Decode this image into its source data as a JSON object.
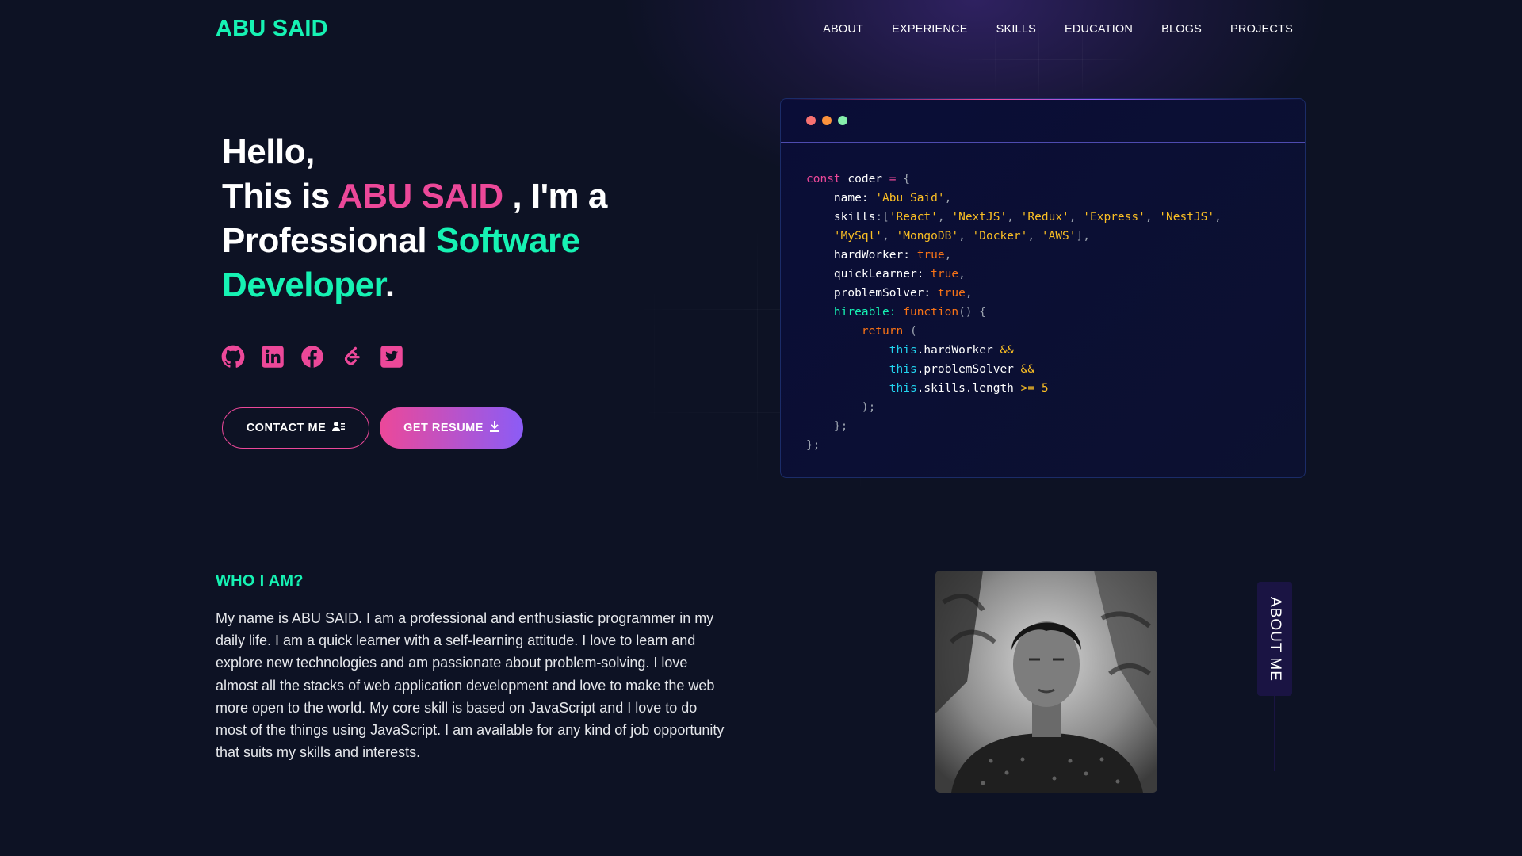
{
  "brand": "ABU SAID",
  "nav": [
    "ABOUT",
    "EXPERIENCE",
    "SKILLS",
    "EDUCATION",
    "BLOGS",
    "PROJECTS"
  ],
  "hero": {
    "hello": "Hello,",
    "this_is": "This is",
    "name": "ABU SAID",
    "im_a": ", I'm a",
    "professional": "Professional",
    "software": "Software",
    "developer": "Developer",
    "period": "."
  },
  "socials": [
    "github-icon",
    "linkedin-icon",
    "facebook-icon",
    "leetcode-icon",
    "twitter-icon"
  ],
  "buttons": {
    "contact": "CONTACT ME",
    "resume": "GET RESUME"
  },
  "code": {
    "l1": {
      "kw": "const",
      "name": " coder",
      "op": " =",
      "brace": " {"
    },
    "l2": {
      "key": "name",
      "colon": ": ",
      "val": "'Abu Said'",
      "comma": ","
    },
    "l3": {
      "key": "skills",
      "colon": ":[",
      "items": [
        "'React'",
        "'NextJS'",
        "'Redux'",
        "'Express'",
        "'NestJS'"
      ]
    },
    "l4": {
      "items": [
        "'MySql'",
        "'MongoDB'",
        "'Docker'",
        "'AWS'"
      ],
      "end": "],"
    },
    "l5": {
      "key": "hardWorker",
      "colon": ": ",
      "val": "true",
      "comma": ","
    },
    "l6": {
      "key": "quickLearner",
      "colon": ": ",
      "val": "true",
      "comma": ","
    },
    "l7": {
      "key": "problemSolver",
      "colon": ": ",
      "val": "true",
      "comma": ","
    },
    "l8": {
      "key": "hireable",
      "colon": ": ",
      "fn": "function",
      "paren": "() {"
    },
    "l9": {
      "kw": "return",
      "paren": " ("
    },
    "l10": {
      "this": "this",
      "prop": ".hardWorker ",
      "op": "&&"
    },
    "l11": {
      "this": "this",
      "prop": ".problemSolver ",
      "op": "&&"
    },
    "l12": {
      "this": "this",
      "prop": ".skills.length ",
      "op": ">= 5"
    },
    "l13": ");",
    "l14": "};",
    "l15": "};"
  },
  "who": {
    "title": "WHO I AM?",
    "text": "My name is ABU SAID. I am a professional and enthusiastic programmer in my daily life. I am a quick learner with a self-learning attitude. I love to learn and explore new technologies and am passionate about problem-solving. I love almost all the stacks of web application development and love to make the web more open to the world. My core skill is based on JavaScript and I love to do most of the things using JavaScript. I am available for any kind of job opportunity that suits my skills and interests."
  },
  "about_tab": "ABOUT ME",
  "colors": {
    "background": "#0d1224",
    "accent_green": "#16f2b3",
    "accent_pink": "#ec4899",
    "accent_violet": "#8b5cf6"
  }
}
